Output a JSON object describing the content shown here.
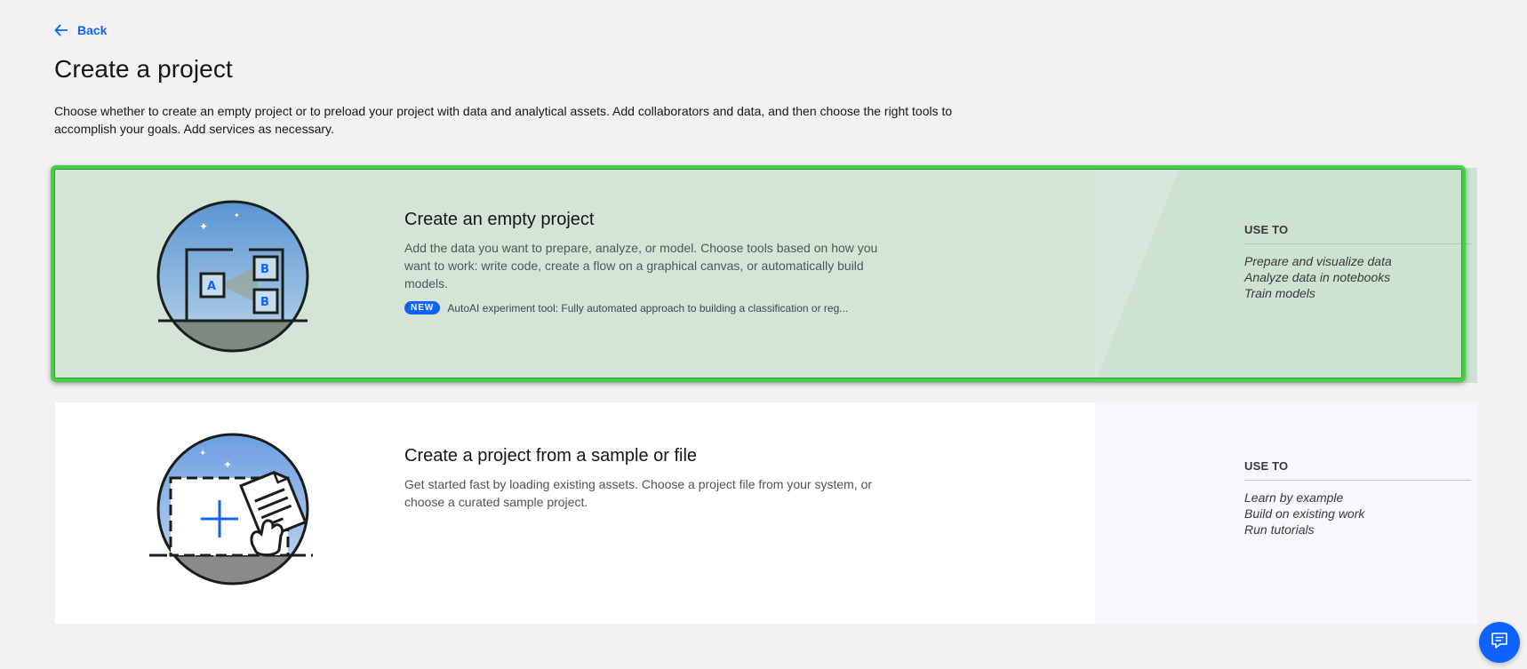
{
  "nav": {
    "back_label": "Back"
  },
  "page": {
    "title": "Create a project",
    "description": "Choose whether to create an empty project or to preload your project with data and analytical assets. Add collaborators and data, and then choose the right tools to accomplish your goals. Add services as necessary."
  },
  "cards": [
    {
      "title": "Create an empty project",
      "description": "Add the data you want to prepare, analyze, or model. Choose tools based on how you want to work: write code, create a flow on a graphical canvas, or automatically build models.",
      "tag": "NEW",
      "tag_text": "AutoAI experiment tool: Fully automated approach to building a classification or reg...",
      "use_to_heading": "USE TO",
      "use_to_items": [
        "Prepare and visualize data",
        "Analyze data in notebooks",
        "Train models"
      ],
      "illustration": "empty-project-illustration",
      "selected": true
    },
    {
      "title": "Create a project from a sample or file",
      "description": "Get started fast by loading existing assets. Choose a project file from your system, or choose a curated sample project.",
      "use_to_heading": "USE TO",
      "use_to_items": [
        "Learn by example",
        "Build on existing work",
        "Run tutorials"
      ],
      "illustration": "sample-project-illustration",
      "selected": false
    }
  ],
  "icons": {
    "back": "arrow-left-icon",
    "chat": "chat-icon"
  },
  "colors": {
    "accent": "#0f62fe",
    "selection_border": "#44d044",
    "selected_card_bg": "#d4e5d8",
    "page_bg": "#f2f2f2"
  }
}
